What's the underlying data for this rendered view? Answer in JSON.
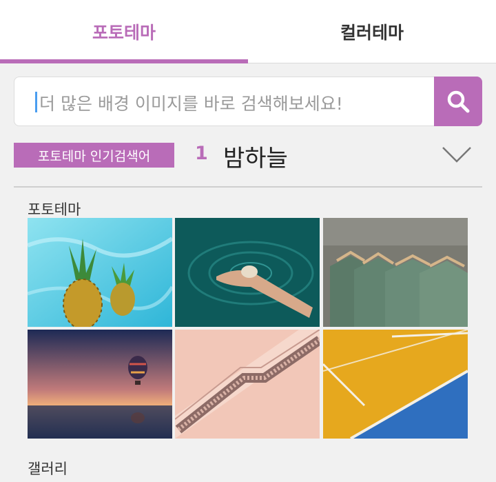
{
  "tabs": [
    {
      "label": "포토테마",
      "active": true
    },
    {
      "label": "컬러테마",
      "active": false
    }
  ],
  "search": {
    "placeholder": "더 많은 배경 이미지를 바로 검색해보세요!",
    "icon": "search-icon"
  },
  "popular": {
    "badge": "포토테마 인기검색어",
    "rank": "1",
    "keyword": "밤하늘",
    "icon": "chevron-down-icon"
  },
  "sections": {
    "photo_theme": "포토테마",
    "gallery": "갤러리"
  },
  "thumbnails": [
    {
      "name": "pineapple-pool"
    },
    {
      "name": "hand-shell-water"
    },
    {
      "name": "tshirts-hangers"
    },
    {
      "name": "hot-air-balloon-sunset"
    },
    {
      "name": "escalator-pink"
    },
    {
      "name": "sports-court"
    }
  ],
  "colors": {
    "accent": "#b96cb8",
    "cursor": "#4a9df0",
    "background": "#f1f1f1"
  }
}
